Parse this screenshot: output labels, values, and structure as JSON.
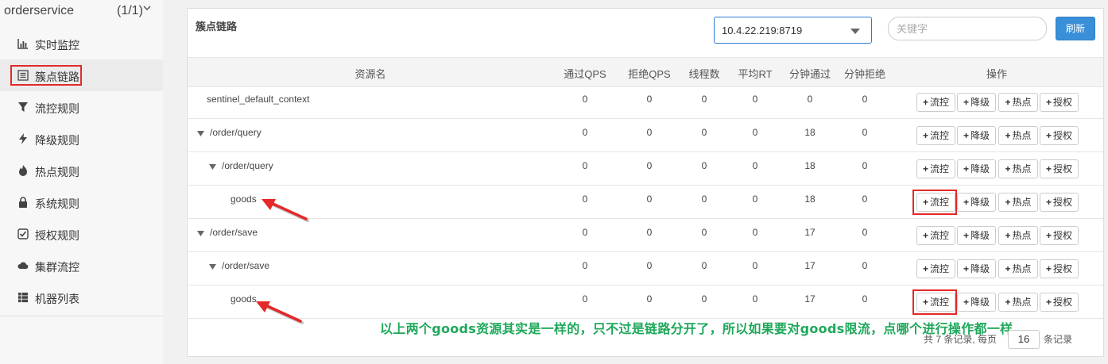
{
  "sidebar": {
    "app_name": "orderservice",
    "app_count": "(1/1)",
    "items": [
      {
        "label": "实时监控",
        "icon": "bar-chart-icon"
      },
      {
        "label": "簇点链路",
        "icon": "list-icon"
      },
      {
        "label": "流控规则",
        "icon": "filter-icon"
      },
      {
        "label": "降级规则",
        "icon": "flash-icon"
      },
      {
        "label": "热点规则",
        "icon": "fire-icon"
      },
      {
        "label": "系统规则",
        "icon": "lock-icon"
      },
      {
        "label": "授权规则",
        "icon": "check-square-icon"
      },
      {
        "label": "集群流控",
        "icon": "cloud-icon"
      },
      {
        "label": "机器列表",
        "icon": "th-list-icon"
      }
    ],
    "active_index": 1
  },
  "panel": {
    "title": "簇点链路",
    "machine": "10.4.22.219:8719",
    "search_placeholder": "关键字",
    "refresh_label": "刷新"
  },
  "table": {
    "headers": [
      "资源名",
      "通过QPS",
      "拒绝QPS",
      "线程数",
      "平均RT",
      "分钟通过",
      "分钟拒绝",
      "操作"
    ],
    "actions": [
      "流控",
      "降级",
      "热点",
      "授权"
    ],
    "rows": [
      {
        "name": "sentinel_default_context",
        "level": 0,
        "toggle": false,
        "values": [
          "0",
          "0",
          "0",
          "0",
          "0",
          "0"
        ],
        "highlight": false
      },
      {
        "name": "/order/query",
        "level": 0,
        "toggle": true,
        "values": [
          "0",
          "0",
          "0",
          "0",
          "18",
          "0"
        ],
        "highlight": false
      },
      {
        "name": "/order/query",
        "level": 1,
        "toggle": true,
        "values": [
          "0",
          "0",
          "0",
          "0",
          "18",
          "0"
        ],
        "highlight": false
      },
      {
        "name": "goods",
        "level": 2,
        "toggle": false,
        "values": [
          "0",
          "0",
          "0",
          "0",
          "18",
          "0"
        ],
        "highlight": true
      },
      {
        "name": "/order/save",
        "level": 0,
        "toggle": true,
        "values": [
          "0",
          "0",
          "0",
          "0",
          "17",
          "0"
        ],
        "highlight": false
      },
      {
        "name": "/order/save",
        "level": 1,
        "toggle": true,
        "values": [
          "0",
          "0",
          "0",
          "0",
          "17",
          "0"
        ],
        "highlight": false
      },
      {
        "name": "goods",
        "level": 2,
        "toggle": false,
        "values": [
          "0",
          "0",
          "0",
          "0",
          "17",
          "0"
        ],
        "highlight": true
      }
    ]
  },
  "pager": {
    "summary": "共 7 条记录, 每页",
    "page_size": "16",
    "suffix": "条记录"
  },
  "annotation": {
    "note": "以上两个goods资源其实是一样的，只不过是链路分开了，所以如果要对goods限流，点哪个进行操作都一样。",
    "color": "#1ea85a",
    "highlight_color": "#e52828"
  }
}
